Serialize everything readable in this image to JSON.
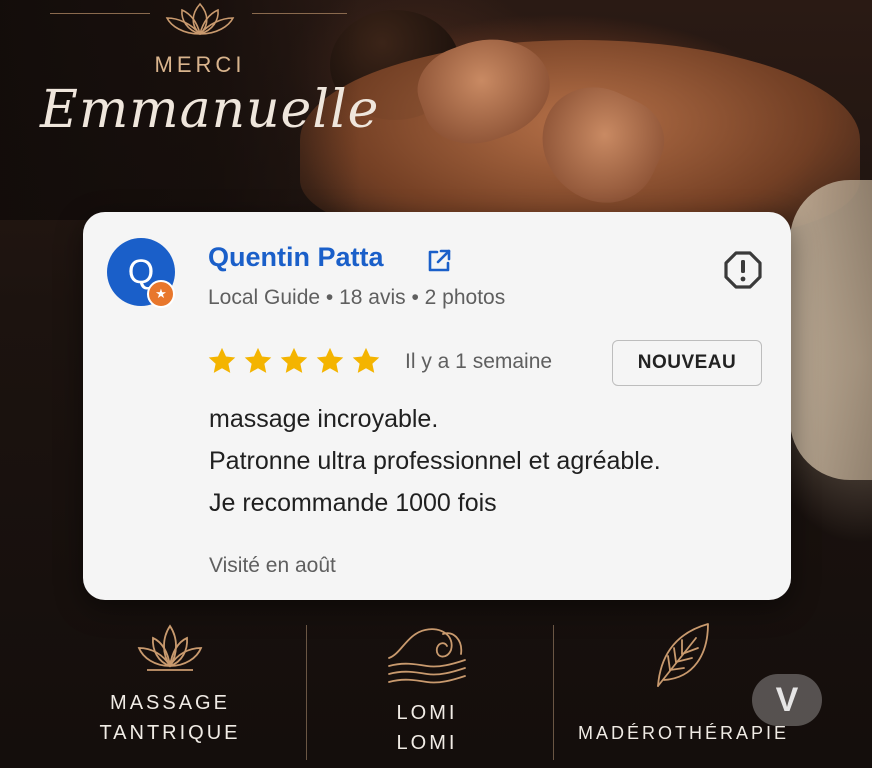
{
  "header": {
    "merci": "MERCI",
    "name_script": "Emmanuelle"
  },
  "review": {
    "avatar_letter": "Q",
    "reviewer_name": "Quentin Patta",
    "reviewer_meta": "Local Guide • 18 avis • 2 photos",
    "rating": 5,
    "time_ago": "Il y a 1 semaine",
    "badge": "NOUVEAU",
    "lines": [
      "massage incroyable.",
      "Patronne ultra professionnel et agréable.",
      "Je recommande 1000 fois"
    ],
    "visited": "Visité en août"
  },
  "features": [
    {
      "icon": "lotus-icon",
      "line1": "MASSAGE",
      "line2": "TANTRIQUE"
    },
    {
      "icon": "wave-icon",
      "line1": "LOMI",
      "line2": "LOMI"
    },
    {
      "icon": "leaf-icon",
      "line1": "MADÉROTHÉRAPIE",
      "line2": ""
    }
  ],
  "watermark": "V",
  "colors": {
    "name_blue": "#1a5fc9",
    "star_gold": "#f4b400",
    "accent_gold": "#d9b48d",
    "card_bg": "#f5f5f5"
  }
}
